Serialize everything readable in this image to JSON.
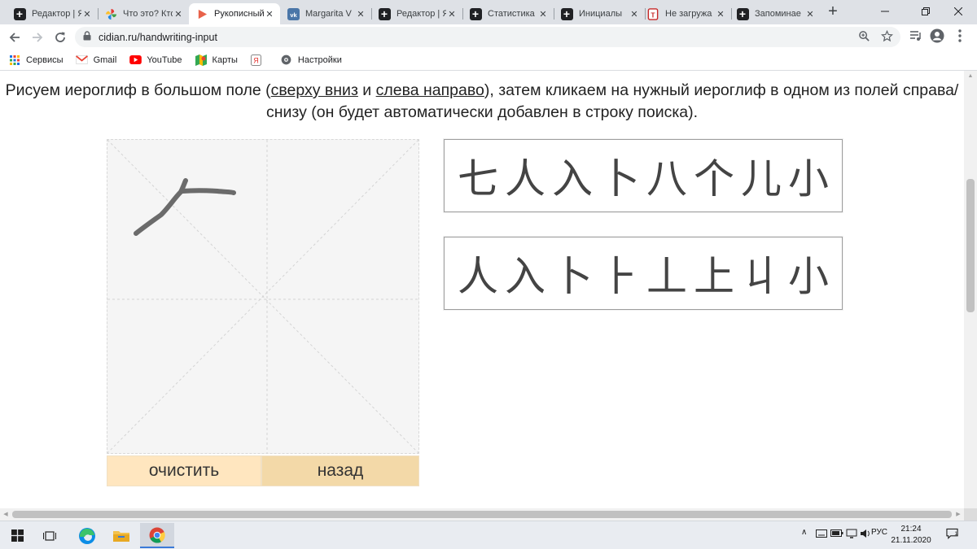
{
  "browser": {
    "tabs": [
      {
        "title": "Редактор | Я",
        "icon": "plus-square-icon"
      },
      {
        "title": "Что это? Кто",
        "icon": "pinwheel-icon"
      },
      {
        "title": "Рукописный",
        "icon": "play-arrow-icon",
        "active": true
      },
      {
        "title": "Margarita V",
        "icon": "vk-icon"
      },
      {
        "title": "Редактор | Я",
        "icon": "plus-square-icon"
      },
      {
        "title": "Статистика",
        "icon": "plus-square-icon"
      },
      {
        "title": "Инициалы",
        "icon": "plus-square-icon"
      },
      {
        "title": "Не загружа",
        "icon": "red-file-icon"
      },
      {
        "title": "Запоминае",
        "icon": "plus-square-icon"
      }
    ],
    "new_tab_label": "+",
    "url": "cidian.ru/handwriting-input",
    "bookmarks": [
      {
        "label": "Сервисы",
        "icon": "apps-grid-icon"
      },
      {
        "label": "Gmail",
        "icon": "gmail-icon"
      },
      {
        "label": "YouTube",
        "icon": "youtube-icon"
      },
      {
        "label": "Карты",
        "icon": "maps-icon"
      },
      {
        "label": "",
        "icon": "yandex-icon"
      },
      {
        "label": "Настройки",
        "icon": "settings-icon"
      }
    ]
  },
  "page": {
    "intro": {
      "part1": "Рисуем иероглиф в большом поле (",
      "link1": "сверху вниз",
      "part2": " и ",
      "link2": "слева направо",
      "part3": "), затем кликаем на нужный иероглиф в одном из полей справа/снизу (он будет автоматически добавлен в строку поиска)."
    },
    "buttons": {
      "clear": "очистить",
      "back": "назад"
    },
    "candidates_row1": [
      "七",
      "人",
      "入",
      "卜",
      "八",
      "个",
      "儿",
      "小"
    ],
    "candidates_row2": [
      "人",
      "入",
      "卜",
      "⺊",
      "丄",
      "上",
      "丩",
      "小"
    ]
  },
  "taskbar": {
    "language": "РУС",
    "time": "21:24",
    "date": "21.11.2020"
  }
}
